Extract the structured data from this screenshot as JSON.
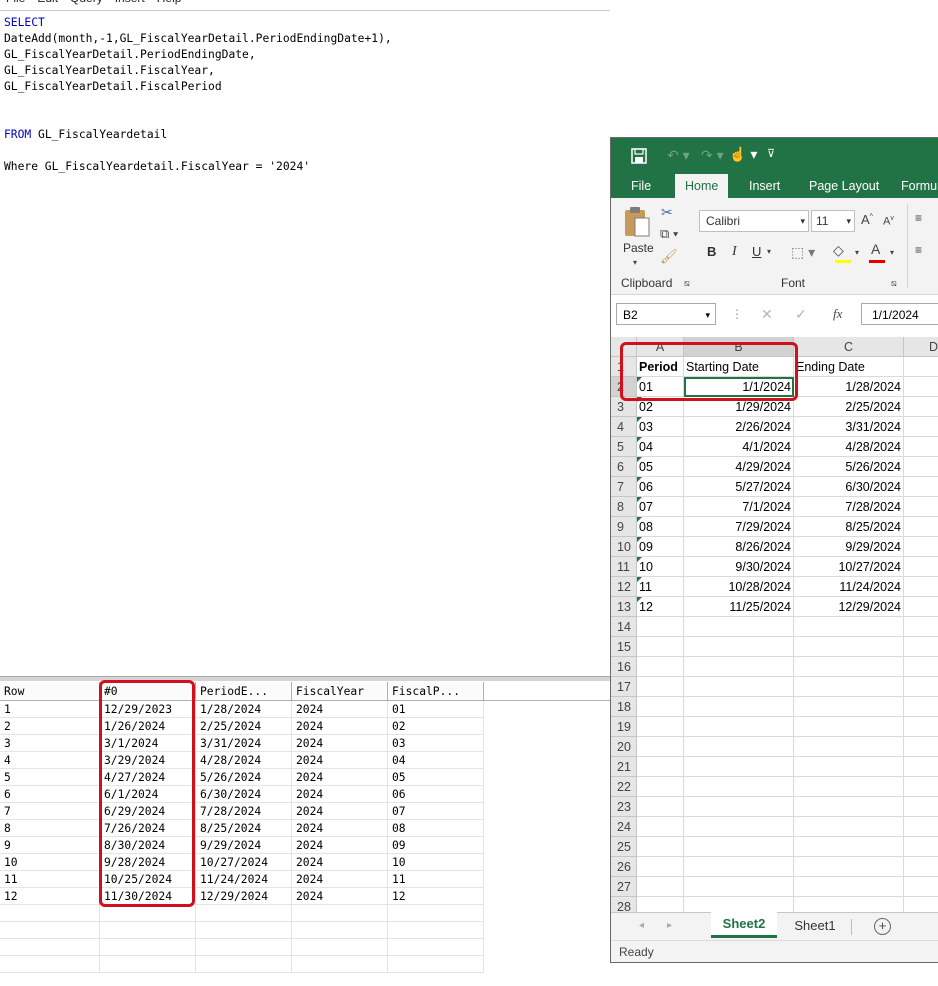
{
  "menu": [
    "File",
    "Edit",
    "Query",
    "Insert",
    "Help"
  ],
  "sql": {
    "lines": [
      {
        "kw": "SELECT",
        "text": ""
      },
      {
        "kw": "",
        "text": "DateAdd(month,-1,GL_FiscalYearDetail.PeriodEndingDate+1),"
      },
      {
        "kw": "",
        "text": "GL_FiscalYearDetail.PeriodEndingDate,"
      },
      {
        "kw": "",
        "text": "GL_FiscalYearDetail.FiscalYear,"
      },
      {
        "kw": "",
        "text": "GL_FiscalYearDetail.FiscalPeriod"
      },
      {
        "kw": "",
        "text": ""
      },
      {
        "kw": "",
        "text": ""
      },
      {
        "kw": "FROM",
        "text": " GL_FiscalYeardetail"
      },
      {
        "kw": "",
        "text": ""
      },
      {
        "kw": "",
        "text": "Where GL_FiscalYeardetail.FiscalYear = '2024'"
      }
    ]
  },
  "results": {
    "headers": [
      "Row",
      "#0",
      "PeriodE...",
      "FiscalYear",
      "FiscalP..."
    ],
    "rows": [
      [
        "1",
        "12/29/2023",
        "1/28/2024",
        "2024",
        "01"
      ],
      [
        "2",
        "1/26/2024",
        "2/25/2024",
        "2024",
        "02"
      ],
      [
        "3",
        "3/1/2024",
        "3/31/2024",
        "2024",
        "03"
      ],
      [
        "4",
        "3/29/2024",
        "4/28/2024",
        "2024",
        "04"
      ],
      [
        "5",
        "4/27/2024",
        "5/26/2024",
        "2024",
        "05"
      ],
      [
        "6",
        "6/1/2024",
        "6/30/2024",
        "2024",
        "06"
      ],
      [
        "7",
        "6/29/2024",
        "7/28/2024",
        "2024",
        "07"
      ],
      [
        "8",
        "7/26/2024",
        "8/25/2024",
        "2024",
        "08"
      ],
      [
        "9",
        "8/30/2024",
        "9/29/2024",
        "2024",
        "09"
      ],
      [
        "10",
        "9/28/2024",
        "10/27/2024",
        "2024",
        "10"
      ],
      [
        "11",
        "10/25/2024",
        "11/24/2024",
        "2024",
        "11"
      ],
      [
        "12",
        "11/30/2024",
        "12/29/2024",
        "2024",
        "12"
      ]
    ]
  },
  "excel": {
    "accent": "#217346",
    "tabs": [
      "File",
      "Home",
      "Insert",
      "Page Layout",
      "Formul"
    ],
    "active_tab": "Home",
    "ribbon": {
      "paste_label": "Paste",
      "clipboard_label": "Clipboard",
      "font_label": "Font",
      "font_name": "Calibri",
      "font_size": "11",
      "bold": "B",
      "italic": "I",
      "underline": "U"
    },
    "name_box": "B2",
    "formula_value": "1/1/2024",
    "fx": "fx",
    "columns": [
      "A",
      "B",
      "C",
      "D"
    ],
    "header_row": [
      "Period",
      "Starting Date",
      "Ending Date"
    ],
    "rows": [
      [
        "01",
        "1/1/2024",
        "1/28/2024"
      ],
      [
        "02",
        "1/29/2024",
        "2/25/2024"
      ],
      [
        "03",
        "2/26/2024",
        "3/31/2024"
      ],
      [
        "04",
        "4/1/2024",
        "4/28/2024"
      ],
      [
        "05",
        "4/29/2024",
        "5/26/2024"
      ],
      [
        "06",
        "5/27/2024",
        "6/30/2024"
      ],
      [
        "07",
        "7/1/2024",
        "7/28/2024"
      ],
      [
        "08",
        "7/29/2024",
        "8/25/2024"
      ],
      [
        "09",
        "8/26/2024",
        "9/29/2024"
      ],
      [
        "10",
        "9/30/2024",
        "10/27/2024"
      ],
      [
        "11",
        "10/28/2024",
        "11/24/2024"
      ],
      [
        "12",
        "11/25/2024",
        "12/29/2024"
      ]
    ],
    "row_numbers": [
      "1",
      "2",
      "3",
      "4",
      "5",
      "6",
      "7",
      "8",
      "9",
      "10",
      "11",
      "12",
      "13",
      "14",
      "15",
      "16",
      "17",
      "18",
      "19",
      "20",
      "21",
      "22",
      "23",
      "24",
      "25",
      "26",
      "27",
      "28"
    ],
    "sheets": [
      "Sheet2",
      "Sheet1"
    ],
    "active_sheet": "Sheet2",
    "add_sheet": "+",
    "status": "Ready"
  }
}
